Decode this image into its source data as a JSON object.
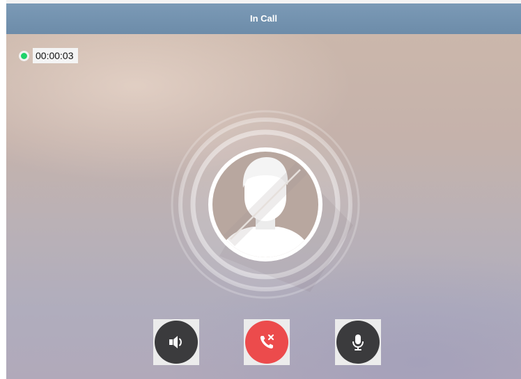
{
  "window": {
    "title": "In Call"
  },
  "call": {
    "status": "connected",
    "status_color": "#1fd36b",
    "duration": "00:00:03",
    "avatar_icon": "user-icon",
    "video_state_icon": "video-off-slash-icon"
  },
  "controls": [
    {
      "name": "speaker",
      "icon": "speaker-icon",
      "color": "#3b3b3d"
    },
    {
      "name": "end-call",
      "icon": "end-call-icon",
      "color": "#ec4b4c"
    },
    {
      "name": "microphone",
      "icon": "microphone-icon",
      "color": "#3b3b3d"
    }
  ],
  "colors": {
    "titlebar": "#7191ad",
    "accent_red": "#ec4b4c",
    "button_dark": "#3b3b3d"
  }
}
